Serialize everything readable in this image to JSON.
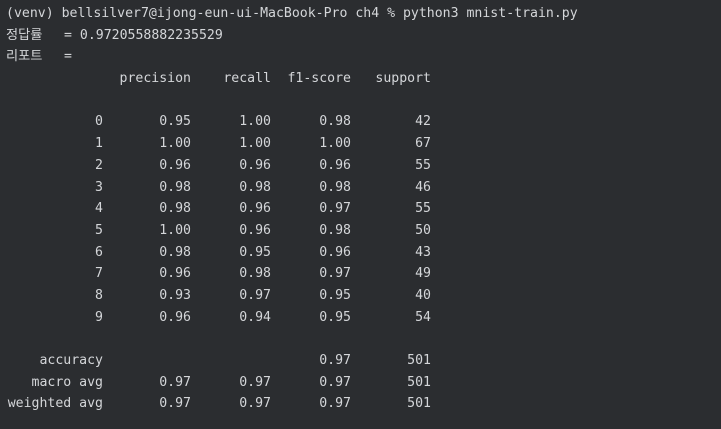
{
  "terminal": {
    "prompt_line": "(venv) bellsilver7@ijong-eun-ui-MacBook-Pro ch4 % python3 mnist-train.py",
    "accuracy_label": "정답률",
    "accuracy_value": "= 0.9720558882235529",
    "report_label": "리포트",
    "report_eq": "="
  },
  "report": {
    "headers": [
      "precision",
      "recall",
      "f1-score",
      "support"
    ],
    "rows": [
      {
        "label": "0",
        "precision": "0.95",
        "recall": "1.00",
        "f1": "0.98",
        "support": "42"
      },
      {
        "label": "1",
        "precision": "1.00",
        "recall": "1.00",
        "f1": "1.00",
        "support": "67"
      },
      {
        "label": "2",
        "precision": "0.96",
        "recall": "0.96",
        "f1": "0.96",
        "support": "55"
      },
      {
        "label": "3",
        "precision": "0.98",
        "recall": "0.98",
        "f1": "0.98",
        "support": "46"
      },
      {
        "label": "4",
        "precision": "0.98",
        "recall": "0.96",
        "f1": "0.97",
        "support": "55"
      },
      {
        "label": "5",
        "precision": "1.00",
        "recall": "0.96",
        "f1": "0.98",
        "support": "50"
      },
      {
        "label": "6",
        "precision": "0.98",
        "recall": "0.95",
        "f1": "0.96",
        "support": "43"
      },
      {
        "label": "7",
        "precision": "0.96",
        "recall": "0.98",
        "f1": "0.97",
        "support": "49"
      },
      {
        "label": "8",
        "precision": "0.93",
        "recall": "0.97",
        "f1": "0.95",
        "support": "40"
      },
      {
        "label": "9",
        "precision": "0.96",
        "recall": "0.94",
        "f1": "0.95",
        "support": "54"
      }
    ],
    "summary": [
      {
        "label": "accuracy",
        "precision": "",
        "recall": "",
        "f1": "0.97",
        "support": "501"
      },
      {
        "label": "macro avg",
        "precision": "0.97",
        "recall": "0.97",
        "f1": "0.97",
        "support": "501"
      },
      {
        "label": "weighted avg",
        "precision": "0.97",
        "recall": "0.97",
        "f1": "0.97",
        "support": "501"
      }
    ]
  },
  "colors": {
    "background": "#2b2d30",
    "text": "#d4d6d9"
  }
}
